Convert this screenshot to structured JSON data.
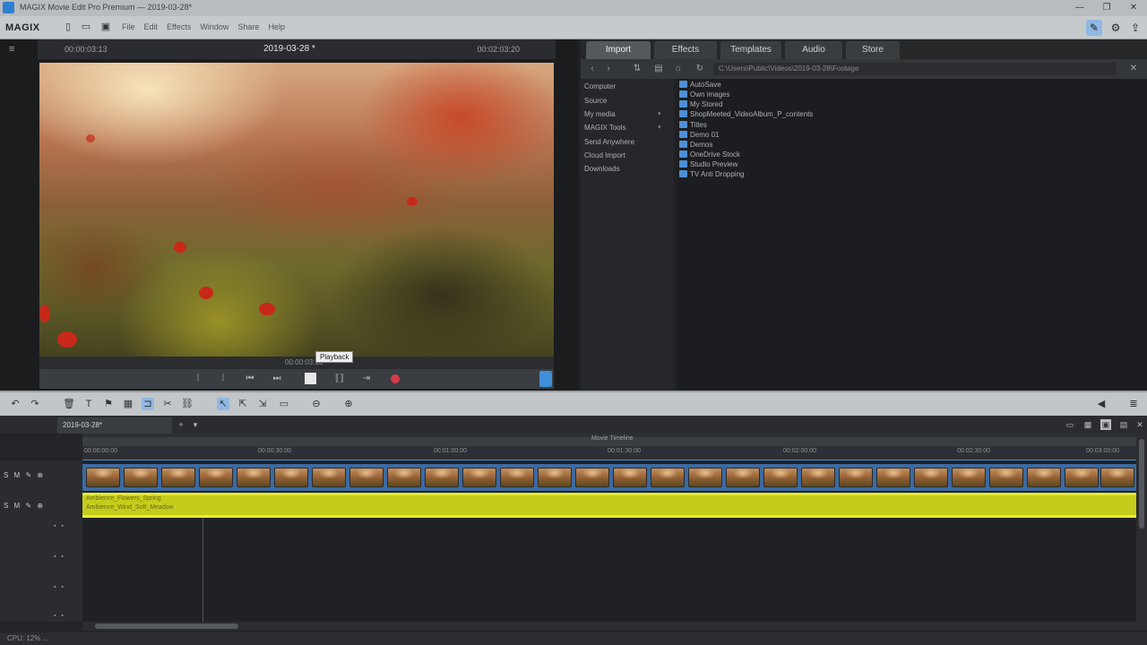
{
  "titlebar": {
    "title": "MAGIX Movie Edit Pro Premium — 2019-03-28*",
    "minimize": "—",
    "maximize": "❐",
    "close": "✕"
  },
  "menubar": {
    "logo": "MAGIX",
    "menus": [
      "File",
      "Edit",
      "Effects",
      "Window",
      "Share",
      "Help"
    ]
  },
  "monitor": {
    "timecode_left": "00:00:03:13",
    "project_name": "2019-03-28 *",
    "timecode_right": "00:02:03:20",
    "scrub_timecode": "00:00:03:13",
    "tooltip": "Playback"
  },
  "pool": {
    "tabs": [
      "Import",
      "Effects",
      "Templates",
      "Audio",
      "Store"
    ],
    "active_tab": "Import",
    "path": "C:\\Users\\Public\\Videos\\2019-03-28\\Footage",
    "nav": [
      {
        "label": "Computer",
        "dropdown": false
      },
      {
        "label": "Source",
        "dropdown": false
      },
      {
        "label": "My media",
        "dropdown": true
      },
      {
        "label": "MAGIX Tools",
        "dropdown": true
      },
      {
        "label": "Send Anywhere",
        "dropdown": false
      },
      {
        "label": "Cloud Import",
        "dropdown": false
      },
      {
        "label": "Downloads",
        "dropdown": false
      }
    ],
    "files": [
      "AutoSave",
      "Own images",
      "My Stored",
      "ShopMeeted_VideoAlbum_P_contents",
      "Titles",
      "Demo 01",
      "Demos",
      "OneDrive Stock",
      "Studio Preview",
      "TV Anti Dropping"
    ]
  },
  "arranger": {
    "project_tab": "2019-03-28*",
    "ruler_title": "Movie Timeline",
    "ruler_ticks": [
      "00:00:00:00",
      "00:00:30:00",
      "00:01:00:00",
      "00:01:30:00",
      "00:02:00:00",
      "00:02:30:00",
      "00:03:00:00"
    ],
    "track_controls": "S M ✎ ⊕",
    "audio_label_1": "Ambience_Flowers_Spring",
    "audio_label_2": "Ambience_Wind_Soft_Meadow"
  },
  "statusbar": {
    "text": "CPU: 12% ..."
  }
}
